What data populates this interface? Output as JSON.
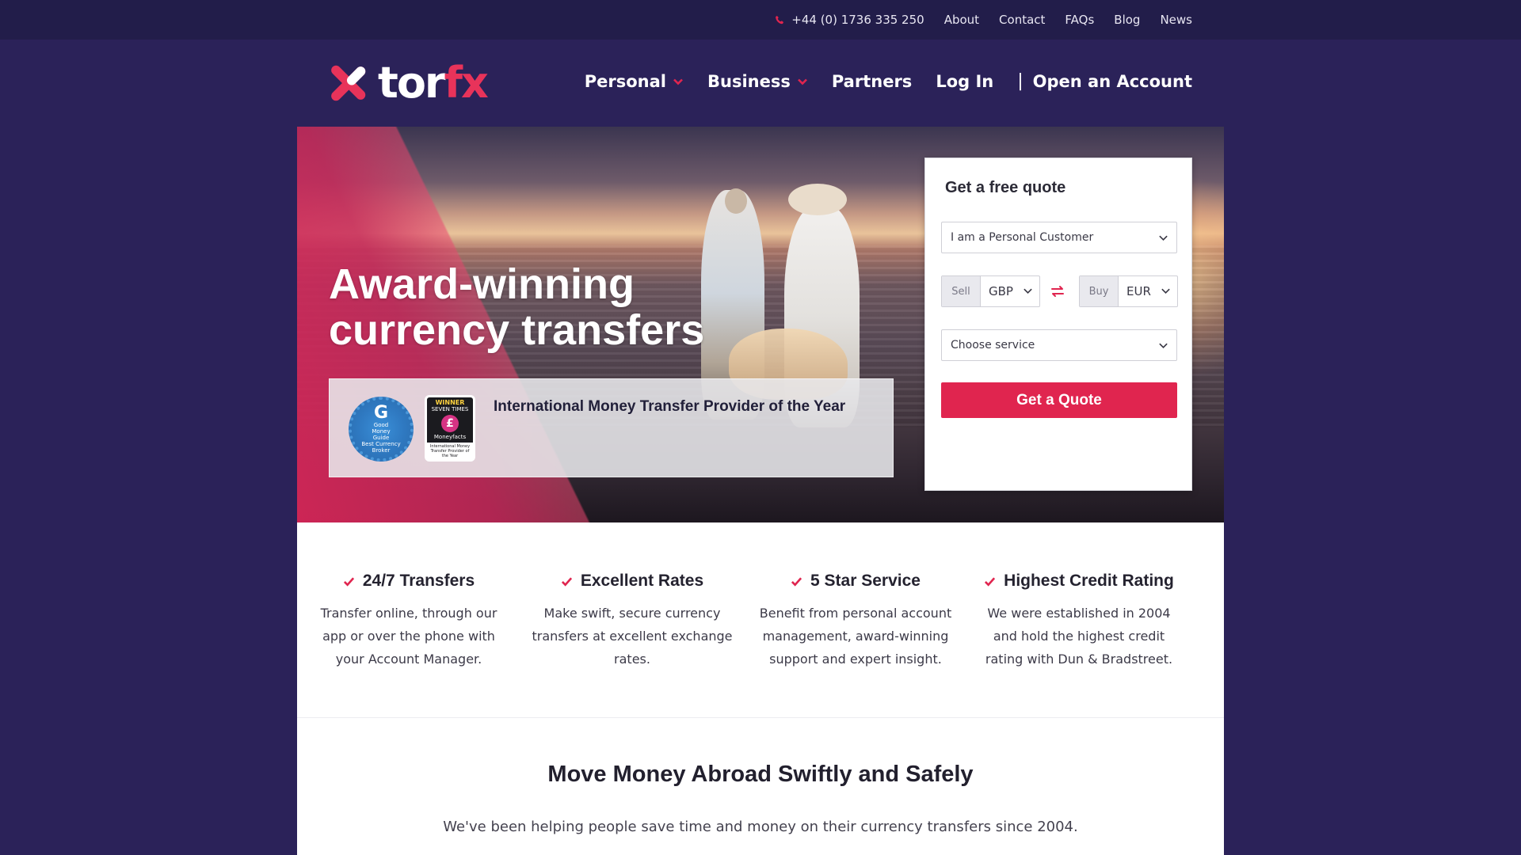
{
  "topbar": {
    "phone": "+44 (0) 1736 335 250",
    "links": [
      "About",
      "Contact",
      "FAQs",
      "Blog",
      "News"
    ]
  },
  "brand": {
    "logo_tor": "tor",
    "logo_fx": "fx",
    "accent_color": "#e0254f",
    "background_color": "#2b2259"
  },
  "nav": {
    "personal": "Personal",
    "business": "Business",
    "partners": "Partners",
    "login": "Log In",
    "separator": "|",
    "open_account": "Open an Account"
  },
  "hero": {
    "title": "Award-winning currency transfers",
    "award_text": "International Money Transfer Provider of the Year",
    "badge_round": {
      "line1": "Good",
      "line2": "Money",
      "line3": "Guide",
      "line4": "Best Currency Broker"
    },
    "badge_square": {
      "winner": "WINNER",
      "times": "SEVEN TIMES",
      "brand": "Moneyfacts",
      "caption": "International Money Transfer Provider of the Year"
    }
  },
  "quote": {
    "title": "Get a free quote",
    "customer_type": "I am a Personal Customer",
    "sell_label": "Sell",
    "sell_currency": "GBP",
    "buy_label": "Buy",
    "buy_currency": "EUR",
    "service_placeholder": "Choose service",
    "button": "Get a Quote"
  },
  "features": [
    {
      "title": "24/7 Transfers",
      "text": "Transfer online, through our app or over the phone with your Account Manager."
    },
    {
      "title": "Excellent Rates",
      "text": "Make swift, secure currency transfers at excellent exchange rates."
    },
    {
      "title": "5 Star Service",
      "text": "Benefit from personal account management, award-winning support and expert insight."
    },
    {
      "title": "Highest Credit Rating",
      "text": "We were established in 2004 and hold the highest credit rating with Dun & Bradstreet."
    }
  ],
  "section": {
    "title": "Move Money Abroad Swiftly and Safely",
    "subtitle": "We've been helping people save time and money on their currency transfers since 2004."
  }
}
